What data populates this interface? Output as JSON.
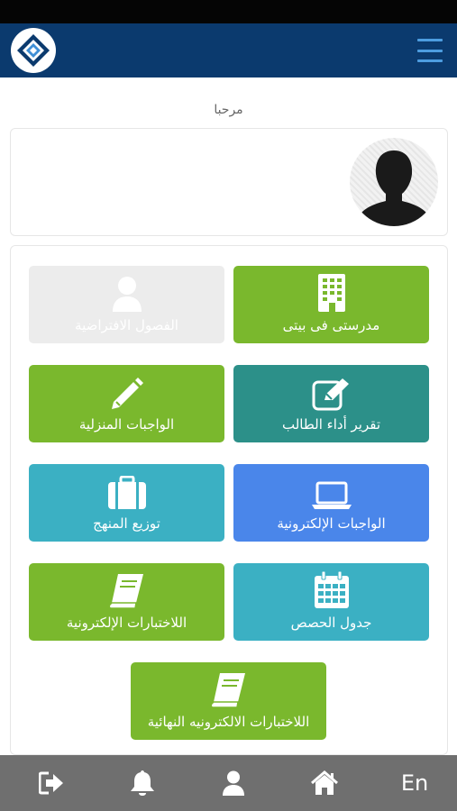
{
  "header": {
    "logo_icon": "app-logo",
    "menu_icon": "hamburger-icon",
    "accent": "#4d9de0",
    "background": "#0b3a6e"
  },
  "welcome": {
    "text": "مرحبا"
  },
  "profile": {
    "avatar_icon": "user-silhouette"
  },
  "tiles": [
    {
      "label": "مدرستى فى بيتى",
      "icon": "building-icon",
      "color": "#7ab82d"
    },
    {
      "label": "الفصول الافتراضية",
      "icon": "user-icon",
      "color": "#ececec"
    },
    {
      "label": "تقرير أداء الطالب",
      "icon": "edit-icon",
      "color": "#2c9089"
    },
    {
      "label": "الواجبات المنزلية",
      "icon": "pencil-icon",
      "color": "#7ab82d"
    },
    {
      "label": "الواجبات الإلكترونية",
      "icon": "laptop-icon",
      "color": "#4a86ea"
    },
    {
      "label": "توزيع المنهج",
      "icon": "suitcase-icon",
      "color": "#3bb0c3"
    },
    {
      "label": "جدول الحصص",
      "icon": "calendar-icon",
      "color": "#3bb0c3"
    },
    {
      "label": "اللاختبارات الإلكترونية",
      "icon": "book-icon",
      "color": "#7ab82d"
    },
    {
      "label": "اللاختبارات الالكترونيه النهائية",
      "icon": "book-icon",
      "color": "#7ab82d"
    }
  ],
  "bottom_nav": {
    "items": [
      {
        "icon": "logout-icon"
      },
      {
        "icon": "bell-icon"
      },
      {
        "icon": "user-icon"
      },
      {
        "icon": "home-icon"
      },
      {
        "icon": "language-toggle",
        "label": "En"
      }
    ],
    "background": "#6f6f6f"
  }
}
